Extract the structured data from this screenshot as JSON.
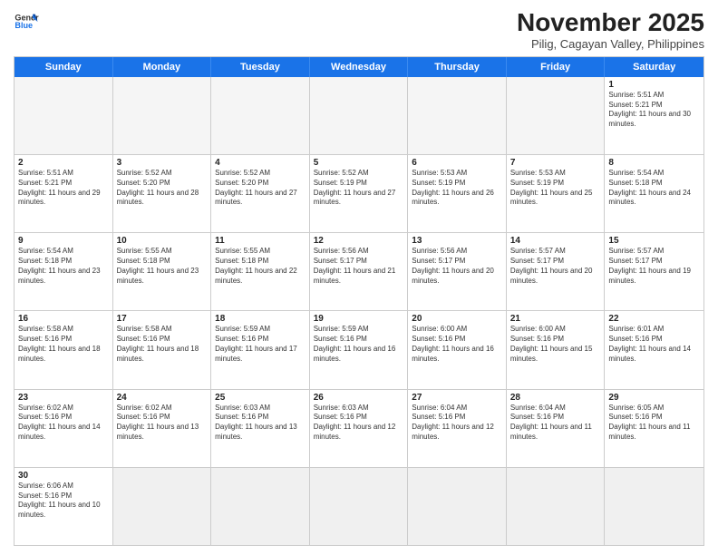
{
  "header": {
    "logo_general": "General",
    "logo_blue": "Blue",
    "title": "November 2025",
    "subtitle": "Pilig, Cagayan Valley, Philippines"
  },
  "days": [
    "Sunday",
    "Monday",
    "Tuesday",
    "Wednesday",
    "Thursday",
    "Friday",
    "Saturday"
  ],
  "rows": [
    [
      {
        "day": "",
        "empty": true
      },
      {
        "day": "",
        "empty": true
      },
      {
        "day": "",
        "empty": true
      },
      {
        "day": "",
        "empty": true
      },
      {
        "day": "",
        "empty": true
      },
      {
        "day": "",
        "empty": true
      },
      {
        "day": "1",
        "sunrise": "5:51 AM",
        "sunset": "5:21 PM",
        "daylight": "11 hours and 30 minutes."
      }
    ],
    [
      {
        "day": "2",
        "sunrise": "5:51 AM",
        "sunset": "5:21 PM",
        "daylight": "11 hours and 29 minutes."
      },
      {
        "day": "3",
        "sunrise": "5:52 AM",
        "sunset": "5:20 PM",
        "daylight": "11 hours and 28 minutes."
      },
      {
        "day": "4",
        "sunrise": "5:52 AM",
        "sunset": "5:20 PM",
        "daylight": "11 hours and 27 minutes."
      },
      {
        "day": "5",
        "sunrise": "5:52 AM",
        "sunset": "5:19 PM",
        "daylight": "11 hours and 27 minutes."
      },
      {
        "day": "6",
        "sunrise": "5:53 AM",
        "sunset": "5:19 PM",
        "daylight": "11 hours and 26 minutes."
      },
      {
        "day": "7",
        "sunrise": "5:53 AM",
        "sunset": "5:19 PM",
        "daylight": "11 hours and 25 minutes."
      },
      {
        "day": "8",
        "sunrise": "5:54 AM",
        "sunset": "5:18 PM",
        "daylight": "11 hours and 24 minutes."
      }
    ],
    [
      {
        "day": "9",
        "sunrise": "5:54 AM",
        "sunset": "5:18 PM",
        "daylight": "11 hours and 23 minutes."
      },
      {
        "day": "10",
        "sunrise": "5:55 AM",
        "sunset": "5:18 PM",
        "daylight": "11 hours and 23 minutes."
      },
      {
        "day": "11",
        "sunrise": "5:55 AM",
        "sunset": "5:18 PM",
        "daylight": "11 hours and 22 minutes."
      },
      {
        "day": "12",
        "sunrise": "5:56 AM",
        "sunset": "5:17 PM",
        "daylight": "11 hours and 21 minutes."
      },
      {
        "day": "13",
        "sunrise": "5:56 AM",
        "sunset": "5:17 PM",
        "daylight": "11 hours and 20 minutes."
      },
      {
        "day": "14",
        "sunrise": "5:57 AM",
        "sunset": "5:17 PM",
        "daylight": "11 hours and 20 minutes."
      },
      {
        "day": "15",
        "sunrise": "5:57 AM",
        "sunset": "5:17 PM",
        "daylight": "11 hours and 19 minutes."
      }
    ],
    [
      {
        "day": "16",
        "sunrise": "5:58 AM",
        "sunset": "5:16 PM",
        "daylight": "11 hours and 18 minutes."
      },
      {
        "day": "17",
        "sunrise": "5:58 AM",
        "sunset": "5:16 PM",
        "daylight": "11 hours and 18 minutes."
      },
      {
        "day": "18",
        "sunrise": "5:59 AM",
        "sunset": "5:16 PM",
        "daylight": "11 hours and 17 minutes."
      },
      {
        "day": "19",
        "sunrise": "5:59 AM",
        "sunset": "5:16 PM",
        "daylight": "11 hours and 16 minutes."
      },
      {
        "day": "20",
        "sunrise": "6:00 AM",
        "sunset": "5:16 PM",
        "daylight": "11 hours and 16 minutes."
      },
      {
        "day": "21",
        "sunrise": "6:00 AM",
        "sunset": "5:16 PM",
        "daylight": "11 hours and 15 minutes."
      },
      {
        "day": "22",
        "sunrise": "6:01 AM",
        "sunset": "5:16 PM",
        "daylight": "11 hours and 14 minutes."
      }
    ],
    [
      {
        "day": "23",
        "sunrise": "6:02 AM",
        "sunset": "5:16 PM",
        "daylight": "11 hours and 14 minutes."
      },
      {
        "day": "24",
        "sunrise": "6:02 AM",
        "sunset": "5:16 PM",
        "daylight": "11 hours and 13 minutes."
      },
      {
        "day": "25",
        "sunrise": "6:03 AM",
        "sunset": "5:16 PM",
        "daylight": "11 hours and 13 minutes."
      },
      {
        "day": "26",
        "sunrise": "6:03 AM",
        "sunset": "5:16 PM",
        "daylight": "11 hours and 12 minutes."
      },
      {
        "day": "27",
        "sunrise": "6:04 AM",
        "sunset": "5:16 PM",
        "daylight": "11 hours and 12 minutes."
      },
      {
        "day": "28",
        "sunrise": "6:04 AM",
        "sunset": "5:16 PM",
        "daylight": "11 hours and 11 minutes."
      },
      {
        "day": "29",
        "sunrise": "6:05 AM",
        "sunset": "5:16 PM",
        "daylight": "11 hours and 11 minutes."
      }
    ],
    [
      {
        "day": "30",
        "sunrise": "6:06 AM",
        "sunset": "5:16 PM",
        "daylight": "11 hours and 10 minutes."
      },
      {
        "day": "",
        "empty": true
      },
      {
        "day": "",
        "empty": true
      },
      {
        "day": "",
        "empty": true
      },
      {
        "day": "",
        "empty": true
      },
      {
        "day": "",
        "empty": true
      },
      {
        "day": "",
        "empty": true
      }
    ]
  ]
}
